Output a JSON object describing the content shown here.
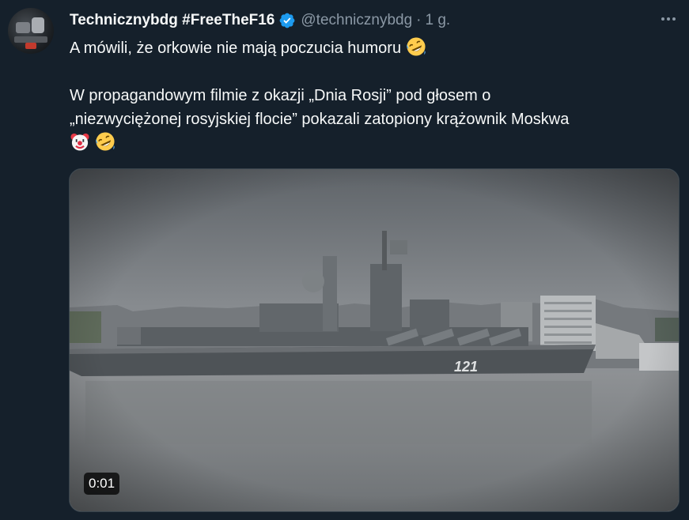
{
  "tweet": {
    "display_name": "Technicznybdg #FreeTheF16",
    "verified": true,
    "handle": "@technicznybdg",
    "separator": "·",
    "time": "1 g.",
    "line1": "A mówili, że orkowie nie mają poczucia humoru",
    "line2": "W propagandowym filmie z okazji „Dnia Rosji” pod głosem o",
    "line3": "„niezwyciężonej rosyjskiej flocie” pokazali zatopiony krążownik Moskwa",
    "emoji_line1": "rolling-on-floor-laughing",
    "emoji_line4": [
      "clown-face",
      "rolling-on-floor-laughing"
    ]
  },
  "media": {
    "type": "video",
    "hull_number": "121",
    "duration": "0:01"
  },
  "colors": {
    "background": "#15202b",
    "text": "#f7f9f9",
    "muted": "#8b98a5",
    "verified": "#1d9bf0"
  }
}
